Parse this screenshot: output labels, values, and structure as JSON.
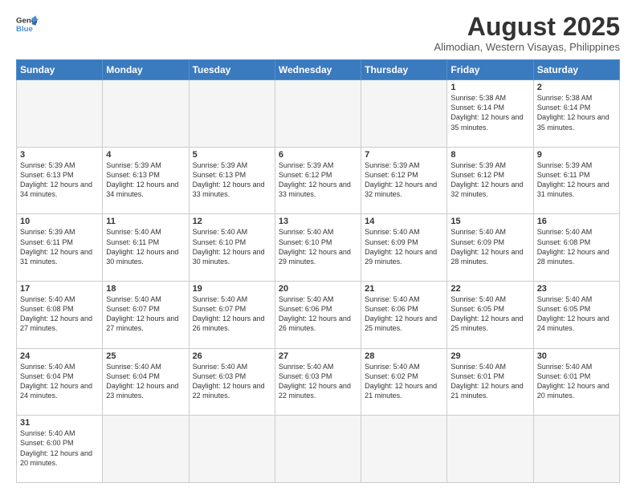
{
  "header": {
    "logo_general": "General",
    "logo_blue": "Blue",
    "month_title": "August 2025",
    "subtitle": "Alimodian, Western Visayas, Philippines"
  },
  "days_of_week": [
    "Sunday",
    "Monday",
    "Tuesday",
    "Wednesday",
    "Thursday",
    "Friday",
    "Saturday"
  ],
  "weeks": [
    [
      {
        "day": "",
        "info": ""
      },
      {
        "day": "",
        "info": ""
      },
      {
        "day": "",
        "info": ""
      },
      {
        "day": "",
        "info": ""
      },
      {
        "day": "",
        "info": ""
      },
      {
        "day": "1",
        "info": "Sunrise: 5:38 AM\nSunset: 6:14 PM\nDaylight: 12 hours\nand 35 minutes."
      },
      {
        "day": "2",
        "info": "Sunrise: 5:38 AM\nSunset: 6:14 PM\nDaylight: 12 hours\nand 35 minutes."
      }
    ],
    [
      {
        "day": "3",
        "info": "Sunrise: 5:39 AM\nSunset: 6:13 PM\nDaylight: 12 hours\nand 34 minutes."
      },
      {
        "day": "4",
        "info": "Sunrise: 5:39 AM\nSunset: 6:13 PM\nDaylight: 12 hours\nand 34 minutes."
      },
      {
        "day": "5",
        "info": "Sunrise: 5:39 AM\nSunset: 6:13 PM\nDaylight: 12 hours\nand 33 minutes."
      },
      {
        "day": "6",
        "info": "Sunrise: 5:39 AM\nSunset: 6:12 PM\nDaylight: 12 hours\nand 33 minutes."
      },
      {
        "day": "7",
        "info": "Sunrise: 5:39 AM\nSunset: 6:12 PM\nDaylight: 12 hours\nand 32 minutes."
      },
      {
        "day": "8",
        "info": "Sunrise: 5:39 AM\nSunset: 6:12 PM\nDaylight: 12 hours\nand 32 minutes."
      },
      {
        "day": "9",
        "info": "Sunrise: 5:39 AM\nSunset: 6:11 PM\nDaylight: 12 hours\nand 31 minutes."
      }
    ],
    [
      {
        "day": "10",
        "info": "Sunrise: 5:39 AM\nSunset: 6:11 PM\nDaylight: 12 hours\nand 31 minutes."
      },
      {
        "day": "11",
        "info": "Sunrise: 5:40 AM\nSunset: 6:11 PM\nDaylight: 12 hours\nand 30 minutes."
      },
      {
        "day": "12",
        "info": "Sunrise: 5:40 AM\nSunset: 6:10 PM\nDaylight: 12 hours\nand 30 minutes."
      },
      {
        "day": "13",
        "info": "Sunrise: 5:40 AM\nSunset: 6:10 PM\nDaylight: 12 hours\nand 29 minutes."
      },
      {
        "day": "14",
        "info": "Sunrise: 5:40 AM\nSunset: 6:09 PM\nDaylight: 12 hours\nand 29 minutes."
      },
      {
        "day": "15",
        "info": "Sunrise: 5:40 AM\nSunset: 6:09 PM\nDaylight: 12 hours\nand 28 minutes."
      },
      {
        "day": "16",
        "info": "Sunrise: 5:40 AM\nSunset: 6:08 PM\nDaylight: 12 hours\nand 28 minutes."
      }
    ],
    [
      {
        "day": "17",
        "info": "Sunrise: 5:40 AM\nSunset: 6:08 PM\nDaylight: 12 hours\nand 27 minutes."
      },
      {
        "day": "18",
        "info": "Sunrise: 5:40 AM\nSunset: 6:07 PM\nDaylight: 12 hours\nand 27 minutes."
      },
      {
        "day": "19",
        "info": "Sunrise: 5:40 AM\nSunset: 6:07 PM\nDaylight: 12 hours\nand 26 minutes."
      },
      {
        "day": "20",
        "info": "Sunrise: 5:40 AM\nSunset: 6:06 PM\nDaylight: 12 hours\nand 26 minutes."
      },
      {
        "day": "21",
        "info": "Sunrise: 5:40 AM\nSunset: 6:06 PM\nDaylight: 12 hours\nand 25 minutes."
      },
      {
        "day": "22",
        "info": "Sunrise: 5:40 AM\nSunset: 6:05 PM\nDaylight: 12 hours\nand 25 minutes."
      },
      {
        "day": "23",
        "info": "Sunrise: 5:40 AM\nSunset: 6:05 PM\nDaylight: 12 hours\nand 24 minutes."
      }
    ],
    [
      {
        "day": "24",
        "info": "Sunrise: 5:40 AM\nSunset: 6:04 PM\nDaylight: 12 hours\nand 24 minutes."
      },
      {
        "day": "25",
        "info": "Sunrise: 5:40 AM\nSunset: 6:04 PM\nDaylight: 12 hours\nand 23 minutes."
      },
      {
        "day": "26",
        "info": "Sunrise: 5:40 AM\nSunset: 6:03 PM\nDaylight: 12 hours\nand 22 minutes."
      },
      {
        "day": "27",
        "info": "Sunrise: 5:40 AM\nSunset: 6:03 PM\nDaylight: 12 hours\nand 22 minutes."
      },
      {
        "day": "28",
        "info": "Sunrise: 5:40 AM\nSunset: 6:02 PM\nDaylight: 12 hours\nand 21 minutes."
      },
      {
        "day": "29",
        "info": "Sunrise: 5:40 AM\nSunset: 6:01 PM\nDaylight: 12 hours\nand 21 minutes."
      },
      {
        "day": "30",
        "info": "Sunrise: 5:40 AM\nSunset: 6:01 PM\nDaylight: 12 hours\nand 20 minutes."
      }
    ],
    [
      {
        "day": "31",
        "info": "Sunrise: 5:40 AM\nSunset: 6:00 PM\nDaylight: 12 hours\nand 20 minutes."
      },
      {
        "day": "",
        "info": ""
      },
      {
        "day": "",
        "info": ""
      },
      {
        "day": "",
        "info": ""
      },
      {
        "day": "",
        "info": ""
      },
      {
        "day": "",
        "info": ""
      },
      {
        "day": "",
        "info": ""
      }
    ]
  ]
}
